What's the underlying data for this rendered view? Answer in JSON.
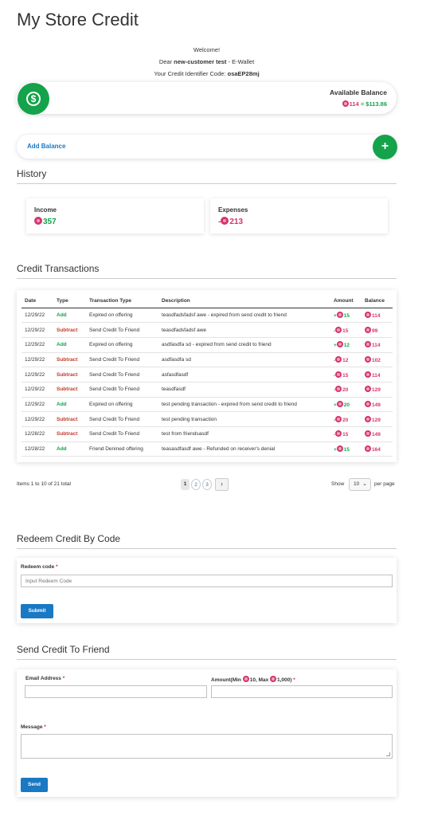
{
  "page_title": "My Store Credit",
  "welcome": {
    "line1": "Welcome!",
    "dear_prefix": "Dear ",
    "customer_name": "new-customer test",
    "dear_suffix": " - E-Wallet",
    "code_prefix": "Your Credit Identifier Code: ",
    "code": "osaEP28mj"
  },
  "balance": {
    "label": "Available Balance",
    "points": "114",
    "equals": " = ",
    "money": "$113.86"
  },
  "add_balance": {
    "label": "Add Balance",
    "plus": "+"
  },
  "history": {
    "title": "History",
    "income_label": "Income",
    "income_value": "357",
    "expenses_label": "Expenses",
    "expenses_sign": "-",
    "expenses_value": "213"
  },
  "transactions": {
    "title": "Credit Transactions",
    "columns": [
      "Date",
      "Type",
      "Transaction Type",
      "Description",
      "Amount",
      "Balance"
    ],
    "rows": [
      {
        "date": "12/29/22",
        "type": "Add",
        "ttype": "Expired on offering",
        "desc": "teasdfadsfadsf awe - expired from send credit to friend",
        "sign": "+",
        "amount": "15",
        "balance": "114"
      },
      {
        "date": "12/29/22",
        "type": "Subtract",
        "ttype": "Send Credit To Friend",
        "desc": "teasdfadsfadsf awe",
        "sign": "-",
        "amount": "15",
        "balance": "99"
      },
      {
        "date": "12/29/22",
        "type": "Add",
        "ttype": "Expired on offering",
        "desc": "asdfasdfa sd - expired from send credit to friend",
        "sign": "+",
        "amount": "12",
        "balance": "114"
      },
      {
        "date": "12/29/22",
        "type": "Subtract",
        "ttype": "Send Credit To Friend",
        "desc": "asdfasdfa sd",
        "sign": "-",
        "amount": "12",
        "balance": "102"
      },
      {
        "date": "12/29/22",
        "type": "Subtract",
        "ttype": "Send Credit To Friend",
        "desc": "asfasdfasdf",
        "sign": "-",
        "amount": "15",
        "balance": "114"
      },
      {
        "date": "12/29/22",
        "type": "Subtract",
        "ttype": "Send Credit To Friend",
        "desc": "teasdfasdf",
        "sign": "-",
        "amount": "20",
        "balance": "129"
      },
      {
        "date": "12/29/22",
        "type": "Add",
        "ttype": "Expired on offering",
        "desc": "test pending transaction - expired from send credit to friend",
        "sign": "+",
        "amount": "20",
        "balance": "149"
      },
      {
        "date": "12/29/22",
        "type": "Subtract",
        "ttype": "Send Credit To Friend",
        "desc": "test pending transaction",
        "sign": "-",
        "amount": "20",
        "balance": "129"
      },
      {
        "date": "12/28/22",
        "type": "Subtract",
        "ttype": "Send Credit To Friend",
        "desc": "test from friendsasdf",
        "sign": "-",
        "amount": "15",
        "balance": "149"
      },
      {
        "date": "12/28/22",
        "type": "Add",
        "ttype": "Friend Denined offering",
        "desc": "teasasdfasdf awe - Refunded on receiver's denial",
        "sign": "+",
        "amount": "15",
        "balance": "164"
      }
    ]
  },
  "pagination": {
    "items_text": "Items 1 to 10 of 21 total",
    "pages": [
      "1",
      "2",
      "3"
    ],
    "current": "1",
    "next": "›",
    "show_label": "Show",
    "limit": "10",
    "per_page": "per page"
  },
  "redeem": {
    "title": "Redeem Credit By Code",
    "label": "Redeem code",
    "required": "*",
    "placeholder": "Input Redeem Code",
    "submit": "Submit"
  },
  "send": {
    "title": "Send Credit To Friend",
    "email_label": "Email Address",
    "amount_label_prefix": "Amount(Min ",
    "amount_min": "10",
    "amount_mid": ", Max ",
    "amount_max": "1,000",
    "amount_suffix": ")",
    "message_label": "Message",
    "required": "*",
    "send_button": "Send"
  },
  "colors": {
    "green": "#14a34a",
    "pink": "#d6336c",
    "red": "#c0392b",
    "link_blue": "#1978c8",
    "button_blue": "#1979c3"
  }
}
